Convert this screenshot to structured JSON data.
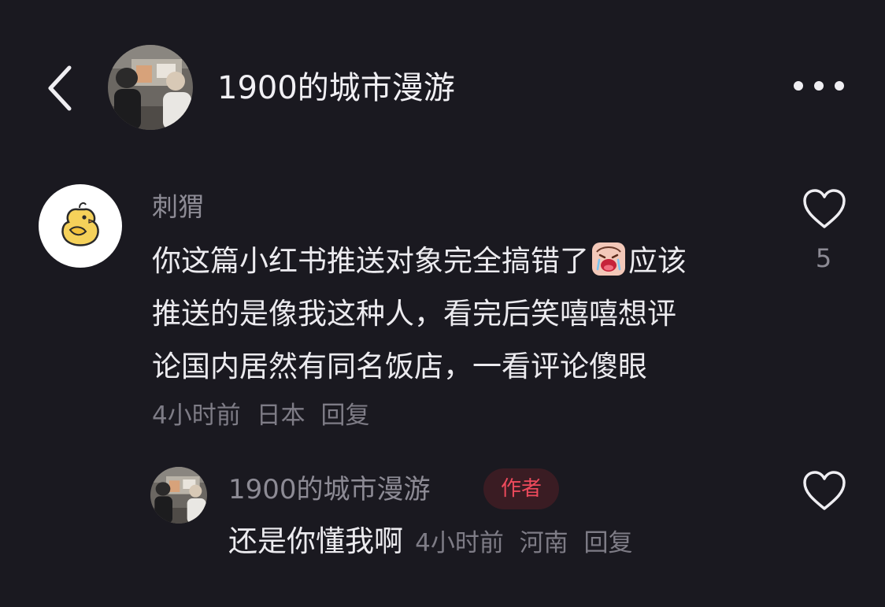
{
  "header": {
    "title": "1900的城市漫游"
  },
  "comment": {
    "author": "刺猬",
    "text_lines": [
      "你这篇小红书推送对象完全搞错了",
      "应该",
      "推送的是像我这种人，看完后笑嘻嘻想评",
      "论国内居然有同名饭店，一看评论傻眼"
    ],
    "time": "4小时前",
    "location": "日本",
    "reply_label": "回复",
    "like_count": "5"
  },
  "reply": {
    "author": "1900的城市漫游",
    "badge": "作者",
    "text": "还是你懂我啊",
    "time": "4小时前",
    "location": "河南",
    "reply_label": "回复"
  },
  "icons": {
    "back": "chevron-left-icon",
    "more": "more-dots-icon",
    "like": "heart-outline-icon",
    "emoji": "crying-face-emoji"
  },
  "colors": {
    "background": "#1a1920",
    "primary_text": "#ecebef",
    "secondary_text": "#8d8b95",
    "badge_text": "#ee4a5c",
    "badge_background": "#3a1c23"
  }
}
